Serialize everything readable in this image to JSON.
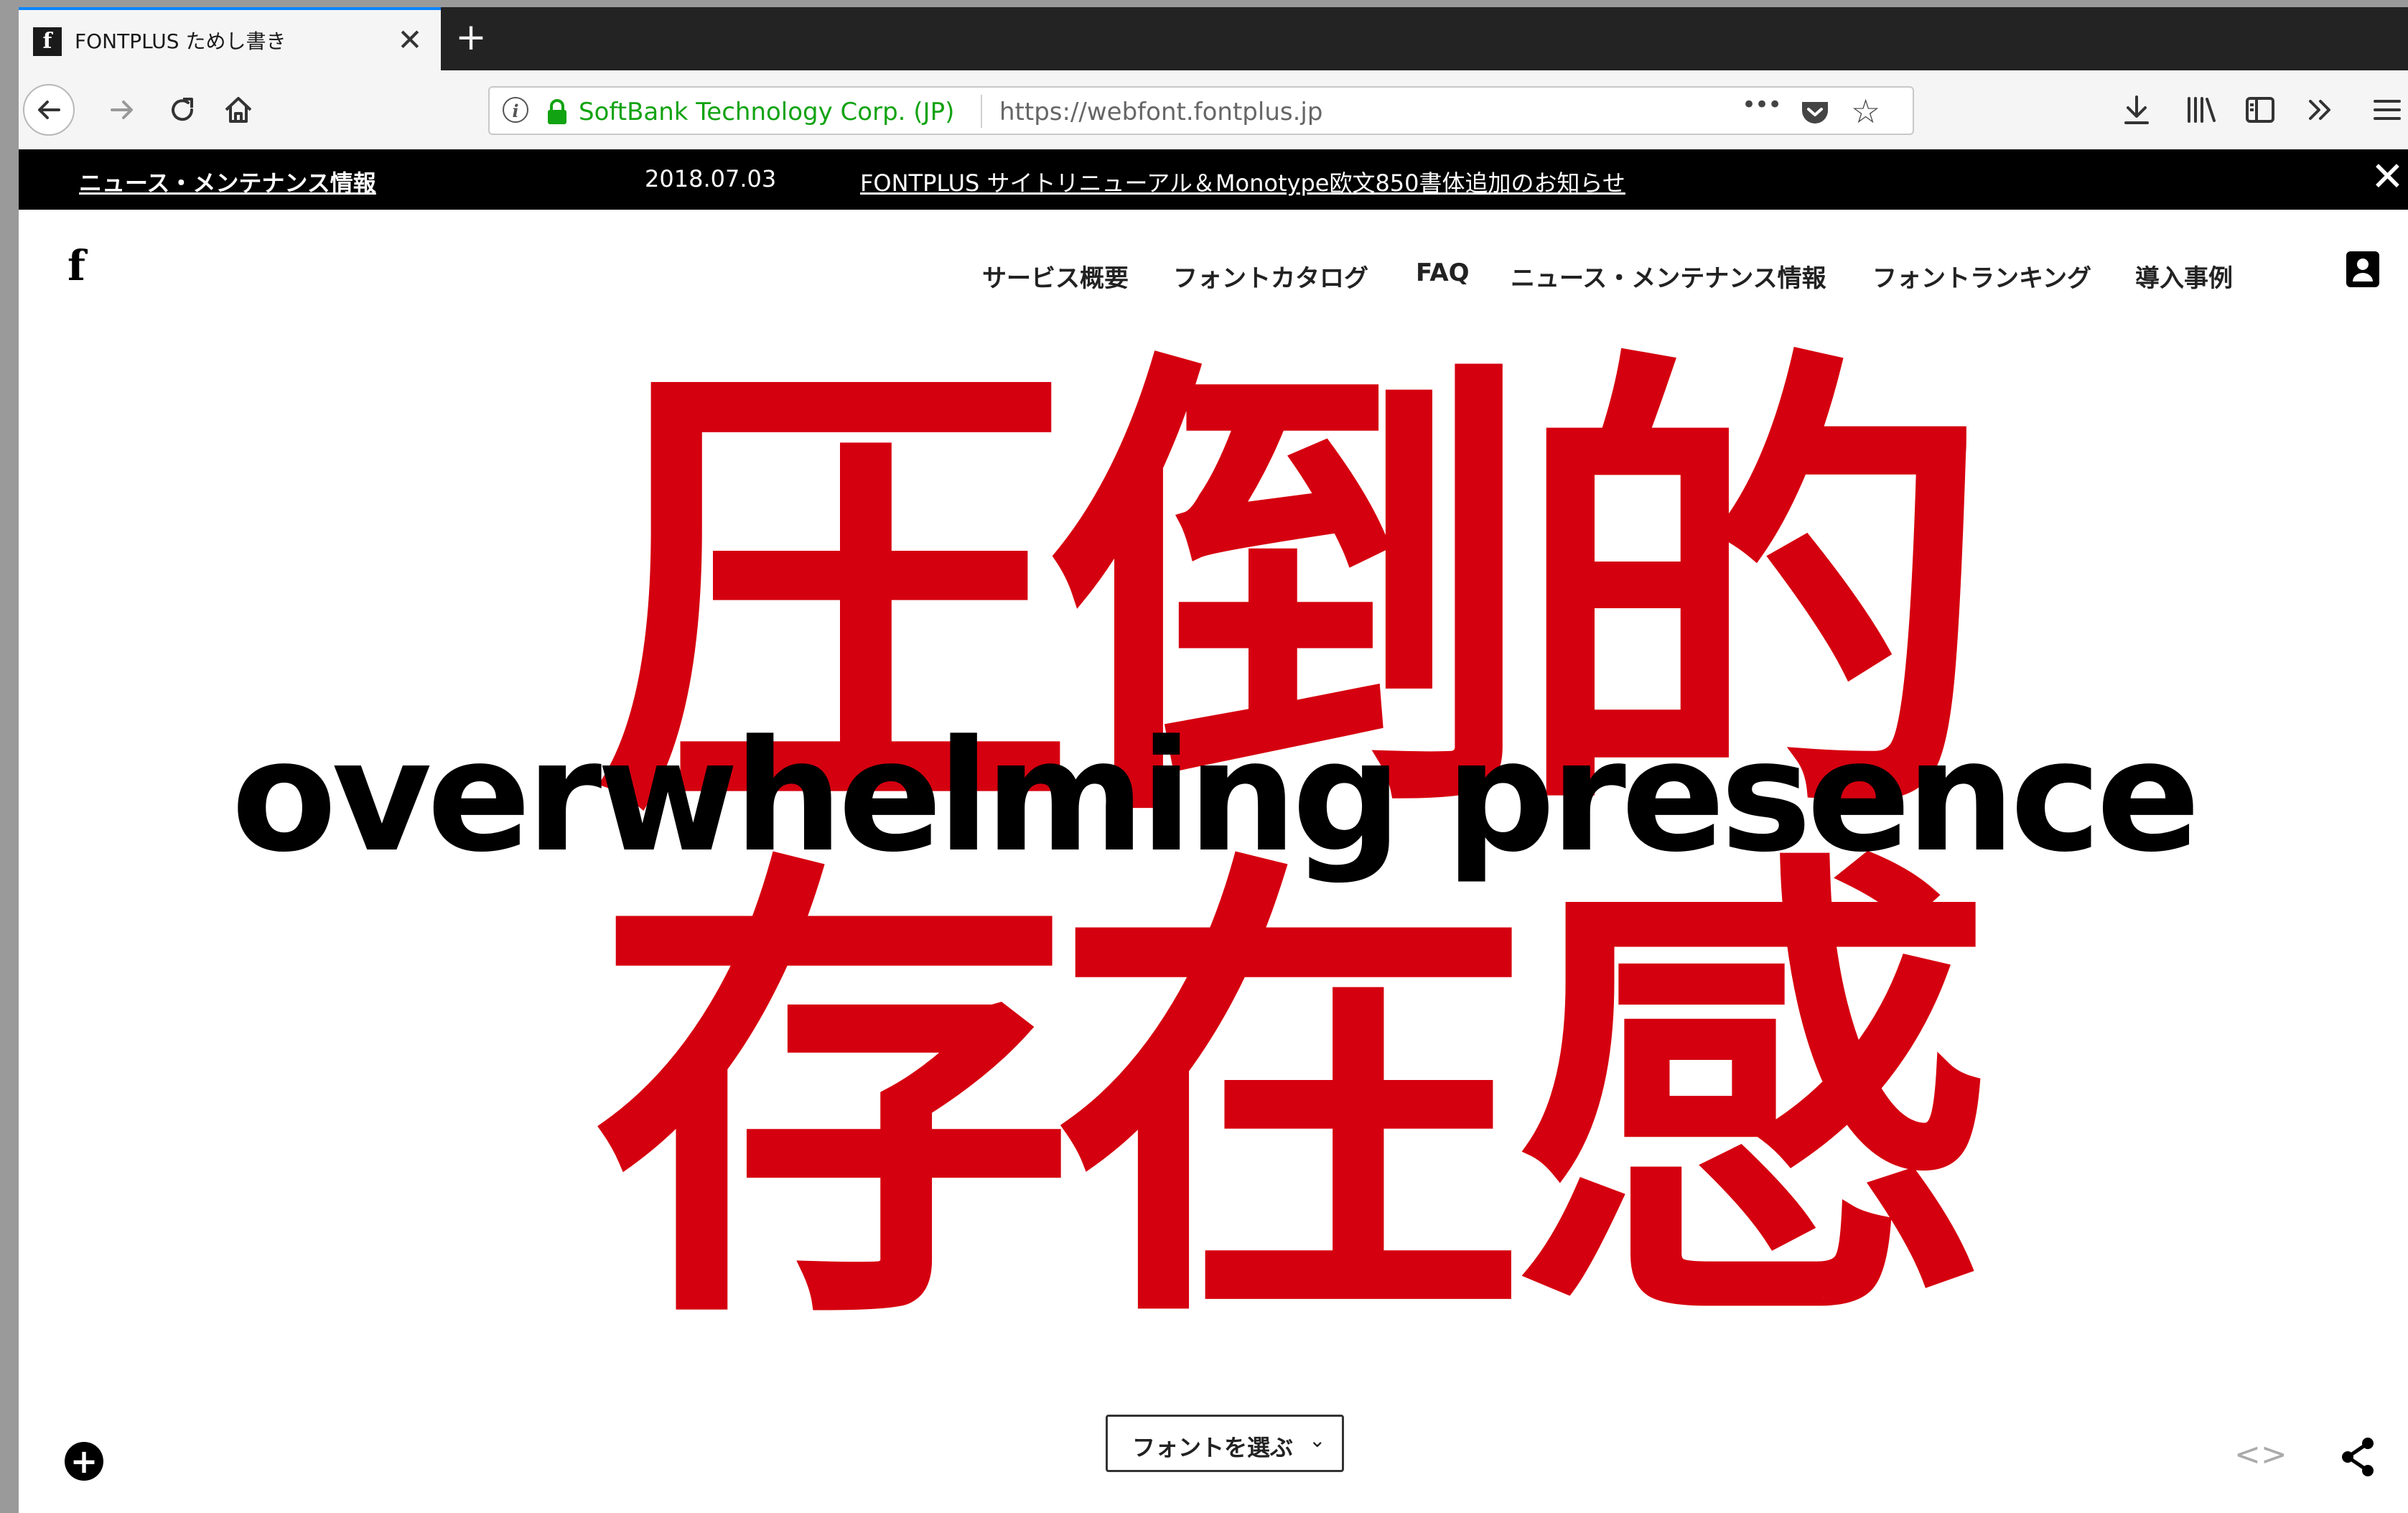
{
  "browser": {
    "tab_title": "FONTPLUS ためし書き",
    "favicon_letter": "f",
    "tab_close": "✕",
    "new_tab": "+",
    "url_org": "SoftBank Technology Corp. (JP)",
    "url": "https://webfont.fontplus.jp",
    "url_more": "•••"
  },
  "newsbar": {
    "label": "ニュース・メンテナンス情報",
    "date": "2018.07.03",
    "link": "FONTPLUS サイトリニューアル＆Monotype欧文850書体追加のお知らせ",
    "close": "✕"
  },
  "site": {
    "logo": "f",
    "nav": [
      "サービス概要",
      "フォントカタログ",
      "FAQ",
      "ニュース・メンテナンス情報",
      "フォントランキング",
      "導入事例"
    ]
  },
  "hero": {
    "jp_line1": "圧倒的",
    "jp_line2": "存在感",
    "en": "overwhelming presence"
  },
  "controls": {
    "font_select": "フォントを選ぶ",
    "code_icon": "<>",
    "plus": "+"
  },
  "colors": {
    "accent_red": "#d5000f",
    "url_green": "#12a312",
    "tab_highlight": "#0a84ff"
  },
  "icons": [
    "back-icon",
    "forward-icon",
    "reload-icon",
    "home-icon",
    "info-icon",
    "lock-icon",
    "pocket-icon",
    "star-icon",
    "download-icon",
    "library-icon",
    "sidebar-icon",
    "overflow-icon",
    "menu-icon",
    "account-icon",
    "add-icon",
    "code-icon",
    "share-icon"
  ]
}
